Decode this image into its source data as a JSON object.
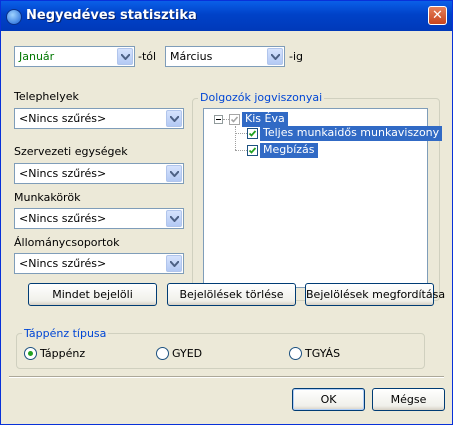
{
  "window": {
    "title": "Negyedéves statisztika"
  },
  "period": {
    "from_value": "Január",
    "from_suffix": "-tól",
    "to_value": "Március",
    "to_suffix": "-ig"
  },
  "filters": {
    "telephelyek_label": "Telephelyek",
    "telephelyek_value": "<Nincs szűrés>",
    "szervezeti_label": "Szervezeti egységek",
    "szervezeti_value": "<Nincs szűrés>",
    "munkakorok_label": "Munkakörök",
    "munkakorok_value": "<Nincs szűrés>",
    "allomany_label": "Állománycsoportok",
    "allomany_value": "<Nincs szűrés>"
  },
  "tree": {
    "group_title": "Dolgozók jogviszonyai",
    "root_label": "Kis Éva",
    "children": [
      "Teljes munkaidős munkaviszony",
      "Megbízás"
    ]
  },
  "buttons": {
    "select_all": "Mindet bejelöli",
    "clear": "Bejelölések törlése",
    "invert": "Bejelölések megfordítása",
    "ok": "OK",
    "cancel": "Mégse"
  },
  "sick_leave": {
    "group_title": "Táppénz típusa",
    "options": [
      "Táppénz",
      "GYED",
      "TGYÁS"
    ],
    "selected": "Táppénz"
  },
  "icons": {
    "close": "close-icon",
    "app": "app-icon",
    "dropdown": "chevron-down-icon",
    "check": "checkmark-icon"
  }
}
